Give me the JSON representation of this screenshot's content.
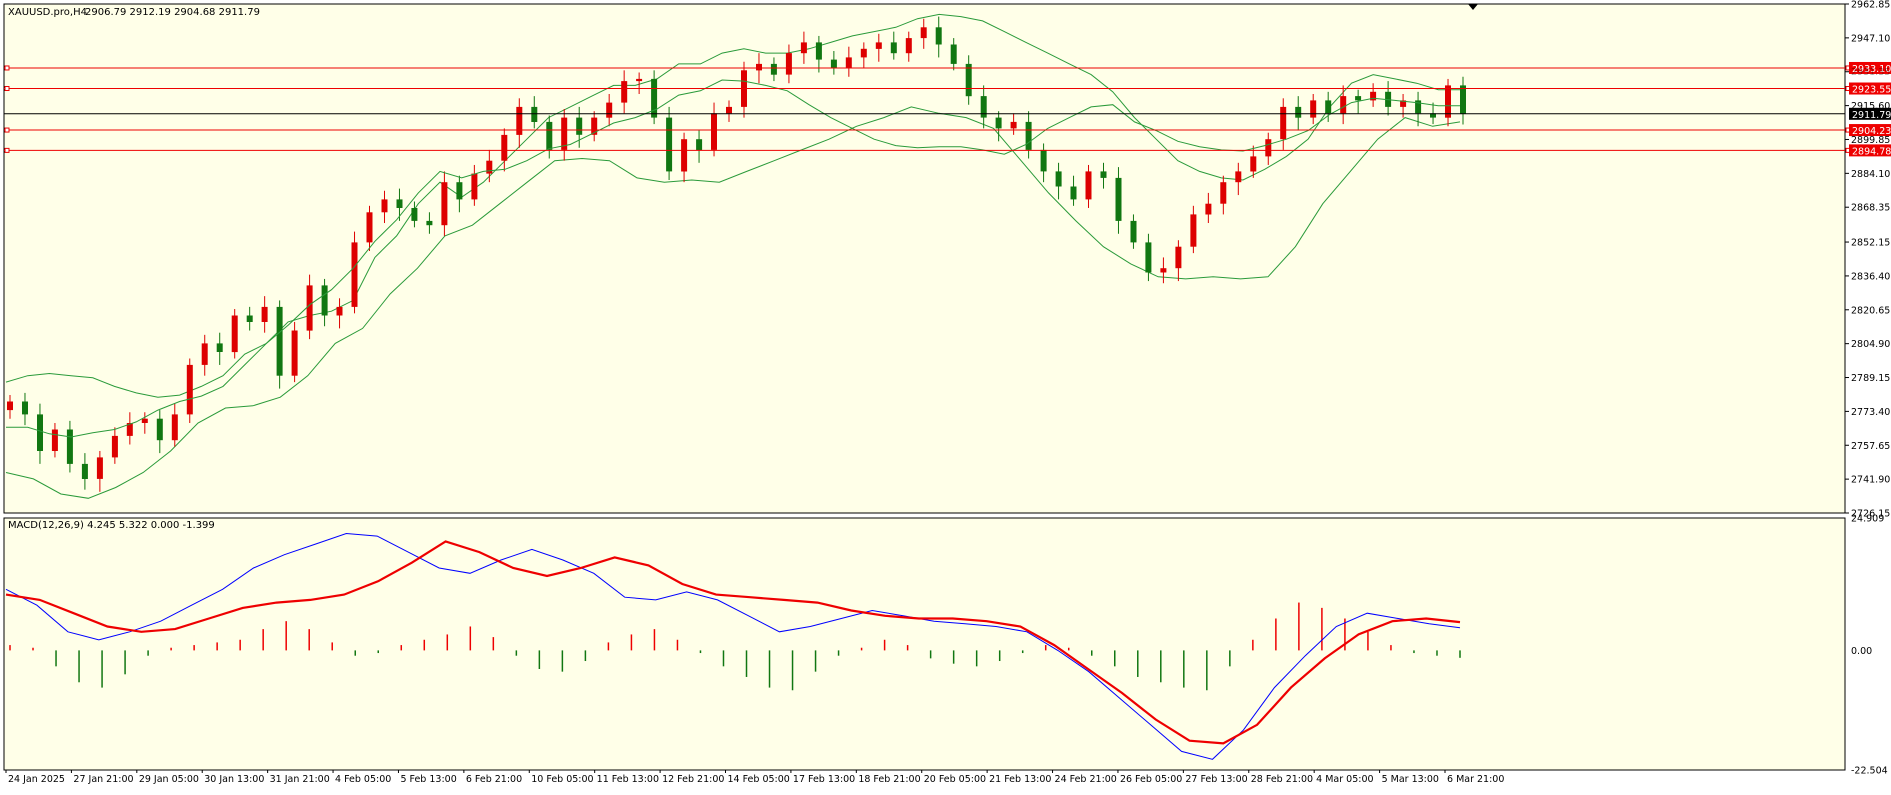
{
  "header": {
    "symbol": "XAUUSD.pro,H4",
    "ohlc": "2906.79 2912.19 2904.68 2911.79"
  },
  "macd_header": {
    "label": "MACD(12,26,9) 4.245 5.322 0.000 -1.399"
  },
  "colors": {
    "background": "#ffffe8",
    "grid_border": "#000000",
    "bull_candle": "#dd0000",
    "bear_candle": "#117711",
    "bollinger": "#2a9a3a",
    "level_line": "#ee0000",
    "price_line": "#000000",
    "macd_line": "#0000ff",
    "signal_line": "#ee0000",
    "hist_pos": "#ee0000",
    "hist_neg": "#117711"
  },
  "chart_data": [
    {
      "type": "candlestick",
      "title": "XAUUSD.pro,H4",
      "y_range": [
        2726.15,
        2962.85
      ],
      "y_tick_labels": [
        "2962.85",
        "2947.10",
        "2931.35",
        "2915.60",
        "2899.85",
        "2884.10",
        "2868.35",
        "2852.15",
        "2836.40",
        "2820.65",
        "2804.90",
        "2789.15",
        "2773.40",
        "2757.65",
        "2741.90",
        "2726.15"
      ],
      "x_tick_labels": [
        "24 Jan 2025",
        "27 Jan 21:00",
        "29 Jan 05:00",
        "30 Jan 13:00",
        "31 Jan 21:00",
        "4 Feb 05:00",
        "5 Feb 13:00",
        "6 Feb 21:00",
        "10 Feb 05:00",
        "11 Feb 13:00",
        "12 Feb 21:00",
        "14 Feb 05:00",
        "17 Feb 13:00",
        "18 Feb 21:00",
        "20 Feb 05:00",
        "21 Feb 13:00",
        "24 Feb 21:00",
        "26 Feb 05:00",
        "27 Feb 13:00",
        "28 Feb 21:00",
        "4 Mar 05:00",
        "5 Mar 13:00",
        "6 Mar 21:00"
      ],
      "close_path": [
        2778,
        2772,
        2755,
        2765,
        2749,
        2742,
        2752,
        2762,
        2768,
        2770,
        2760,
        2772,
        2795,
        2805,
        2801,
        2818,
        2815,
        2822,
        2790,
        2811,
        2832,
        2818,
        2822,
        2852,
        2866,
        2872,
        2868,
        2862,
        2860,
        2880,
        2872,
        2884,
        2890,
        2902,
        2915,
        2908,
        2895,
        2910,
        2902,
        2910,
        2917,
        2927,
        2928,
        2910,
        2885,
        2900,
        2895,
        2912,
        2915,
        2932,
        2935,
        2930,
        2940,
        2945,
        2937,
        2933,
        2938,
        2942,
        2945,
        2940,
        2947,
        2952,
        2944,
        2935,
        2920,
        2910,
        2905,
        2908,
        2895,
        2885,
        2878,
        2872,
        2885,
        2882,
        2862,
        2852,
        2838,
        2840,
        2850,
        2865,
        2870,
        2880,
        2885,
        2892,
        2900,
        2915,
        2910,
        2918,
        2912,
        2920,
        2918,
        2922,
        2915,
        2918,
        2912,
        2910,
        2925,
        2911.79
      ],
      "bollinger": {
        "upper": [
          2787,
          2790,
          2791,
          2790,
          2789,
          2785,
          2782,
          2780,
          2781,
          2785,
          2790,
          2800,
          2805,
          2815,
          2818,
          2820,
          2825,
          2845,
          2855,
          2870,
          2880,
          2873,
          2880,
          2890,
          2900,
          2910,
          2915,
          2920,
          2925,
          2925,
          2928,
          2935,
          2935,
          2940,
          2942,
          2940,
          2940,
          2942,
          2945,
          2948,
          2950,
          2952,
          2956,
          2958,
          2957,
          2955,
          2950,
          2945,
          2940,
          2935,
          2930,
          2922,
          2910,
          2900,
          2890,
          2885,
          2882,
          2881,
          2886,
          2892,
          2900,
          2915,
          2926,
          2930,
          2928,
          2926,
          2923,
          2923
        ],
        "lower": [
          2745,
          2742,
          2735,
          2733,
          2738,
          2745,
          2755,
          2768,
          2775,
          2776,
          2780,
          2790,
          2805,
          2812,
          2828,
          2840,
          2855,
          2860,
          2870,
          2880,
          2890,
          2891,
          2890,
          2882,
          2880,
          2881,
          2880,
          2885,
          2890,
          2895,
          2900,
          2906,
          2910,
          2915,
          2912,
          2910,
          2905,
          2890,
          2875,
          2862,
          2850,
          2842,
          2836,
          2835,
          2836,
          2835,
          2836,
          2850,
          2870,
          2885,
          2900,
          2910,
          2906,
          2908
        ]
      },
      "horizontal_levels": [
        "2933.10",
        "2923.55",
        "2904.23",
        "2894.78"
      ],
      "current_price": "2911.79"
    },
    {
      "type": "macd",
      "title": "MACD(12,26,9) 4.245 5.322 0.000 -1.399",
      "y_range": [
        -22.504,
        24.909
      ],
      "y_tick_labels": [
        "24.909",
        "0.00",
        "-22.504"
      ],
      "macd_line": [
        11.5,
        8.5,
        3.5,
        2,
        3.5,
        5.5,
        8.5,
        11.5,
        15.5,
        18,
        20,
        22,
        21.5,
        18.5,
        15.5,
        14.5,
        17,
        19,
        17,
        14.5,
        10,
        9.5,
        11,
        9.5,
        6.5,
        3.5,
        4.5,
        6,
        7.5,
        6.5,
        5.5,
        5,
        4.5,
        3.5,
        0,
        -4,
        -9,
        -14,
        -19,
        -20.5,
        -15,
        -7,
        -1,
        4.5,
        7,
        6,
        5,
        4.245
      ],
      "signal_line": [
        10.5,
        9.5,
        7,
        4.5,
        3.5,
        4,
        6,
        8,
        9,
        9.5,
        10.5,
        13,
        16.5,
        20.5,
        18.5,
        15.5,
        14,
        15.5,
        17.5,
        16,
        12.5,
        10.5,
        10,
        9.5,
        9,
        7.5,
        6.5,
        6,
        6,
        5.5,
        4.5,
        1,
        -3.5,
        -8,
        -13,
        -17,
        -17.5,
        -14,
        -7,
        -1.5,
        3,
        5.5,
        6,
        5.322
      ],
      "histogram": [
        1,
        0.5,
        -3,
        -6,
        -7,
        -4.5,
        -1,
        0.5,
        1,
        1.5,
        2,
        4,
        5.5,
        4,
        1.5,
        -1,
        -0.5,
        1,
        2,
        3,
        4.5,
        2.5,
        -1,
        -3.5,
        -4,
        -2,
        1.5,
        3,
        4,
        2,
        -0.5,
        -3,
        -5,
        -7,
        -7.5,
        -4,
        -1,
        0.5,
        2,
        1,
        -1.5,
        -2.5,
        -3,
        -2,
        -0.5,
        1,
        0.5,
        -1,
        -3,
        -5,
        -6,
        -7,
        -7.5,
        -3,
        2,
        6,
        9,
        8,
        6,
        3.5,
        1,
        -0.5,
        -1,
        -1.399
      ]
    }
  ]
}
